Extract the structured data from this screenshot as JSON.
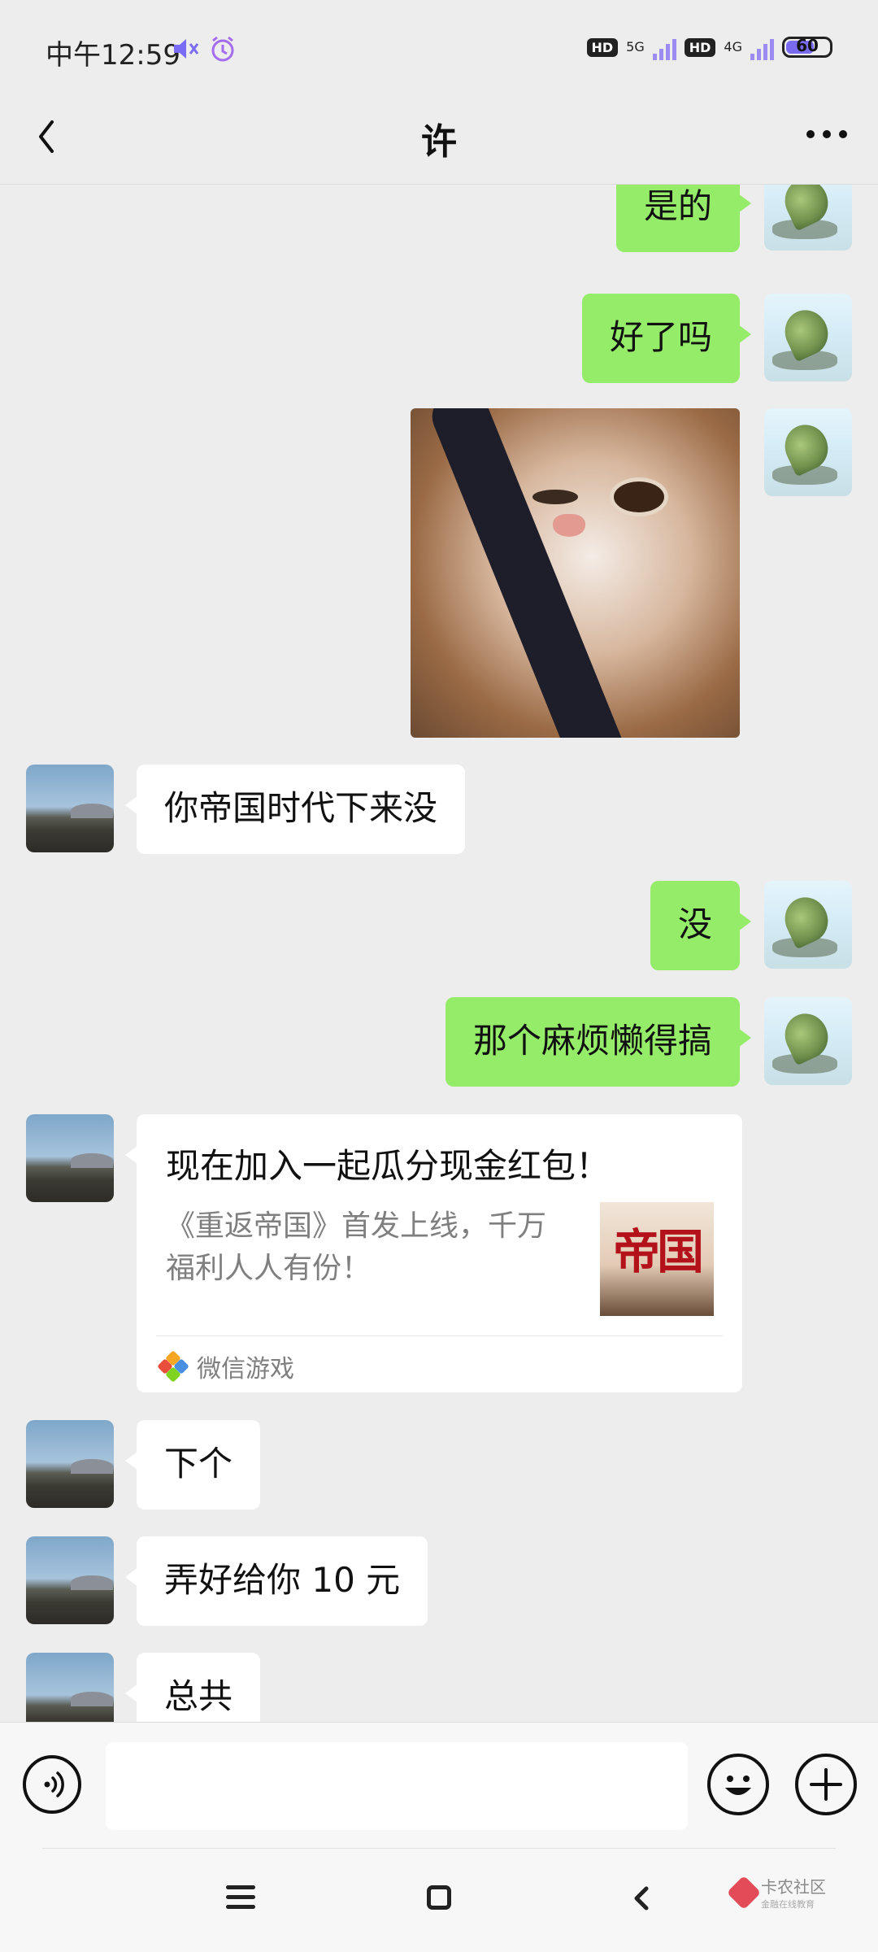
{
  "status_bar": {
    "time": "中午12:59",
    "hd1": "HD",
    "net1": "5G",
    "hd2": "HD",
    "net2": "4G",
    "battery": "60"
  },
  "header": {
    "title": "许"
  },
  "messages": [
    {
      "sender": "me",
      "text": "是的"
    },
    {
      "sender": "me",
      "text": "好了吗"
    },
    {
      "sender": "me",
      "type": "sticker"
    },
    {
      "sender": "other",
      "text": "你帝国时代下来没"
    },
    {
      "sender": "me",
      "text": "没"
    },
    {
      "sender": "me",
      "text": "那个麻烦懒得搞"
    },
    {
      "sender": "other",
      "type": "card"
    },
    {
      "sender": "other",
      "text": "下个"
    },
    {
      "sender": "other",
      "text": "弄好给你 10 元"
    },
    {
      "sender": "other",
      "text": "总共"
    }
  ],
  "card": {
    "title": "现在加入一起瓜分现金红包！",
    "description": "《重返帝国》首发上线，千万福利人人有份！",
    "thumbnail_text": "帝国",
    "source": "微信游戏"
  },
  "input_bar": {
    "placeholder": ""
  },
  "watermark": {
    "main": "卡农社区",
    "sub": "金融在线教育"
  },
  "colors": {
    "my_bubble": "#95ec69",
    "other_bubble": "#ffffff",
    "background": "#ededed"
  }
}
